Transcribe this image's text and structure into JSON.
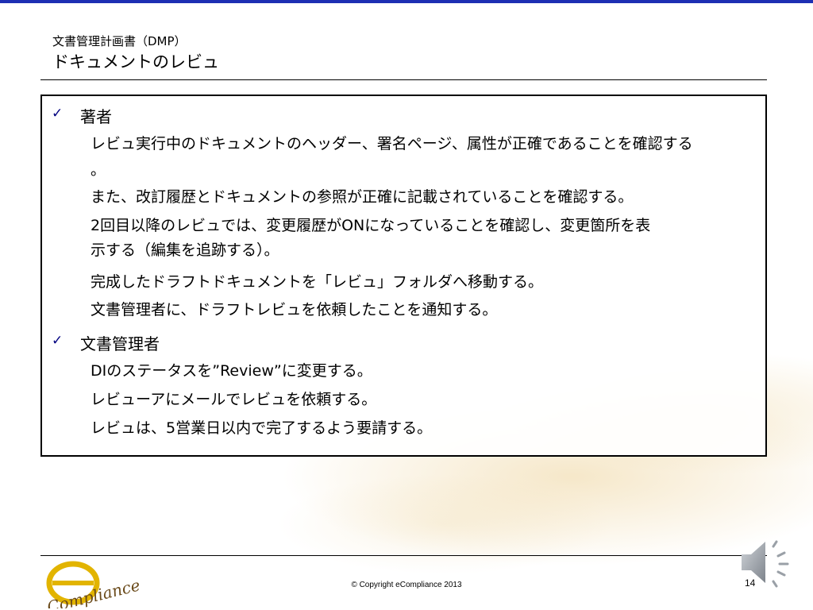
{
  "header": {
    "subtitle": "文書管理計画書（DMP）",
    "title": "ドキュメントのレビュ"
  },
  "sections": [
    {
      "heading": "著者",
      "items": [
        "レビュ実行中のドキュメントのヘッダー、署名ページ、属性が正確であることを確認する",
        "。",
        "また、改訂履歴とドキュメントの参照が正確に記載されていることを確認する。",
        "2回目以降のレビュでは、変更履歴がONになっていることを確認し、変更箇所を表",
        "示する（編集を追跡する）。",
        "完成したドラフトドキュメントを「レビュ」フォルダへ移動する。",
        "文書管理者に、ドラフトレビュを依頼したことを通知する。"
      ]
    },
    {
      "heading": "文書管理者",
      "items": [
        "DIのステータスを”Review”に変更する。",
        "レビューアにメールでレビュを依頼する。",
        "レビュは、5営業日以内で完了するよう要請する。"
      ]
    }
  ],
  "footer": {
    "copyright": "© Copyright eCompliance 2013",
    "page_number": "14",
    "logo_text": "Compliance"
  },
  "icons": {
    "bullet": "checkmark-icon",
    "audio": "speaker-icon"
  },
  "colors": {
    "top_bar": "#1d2fb3",
    "bullet": "#000080",
    "logo_gold": "#e2b400"
  }
}
